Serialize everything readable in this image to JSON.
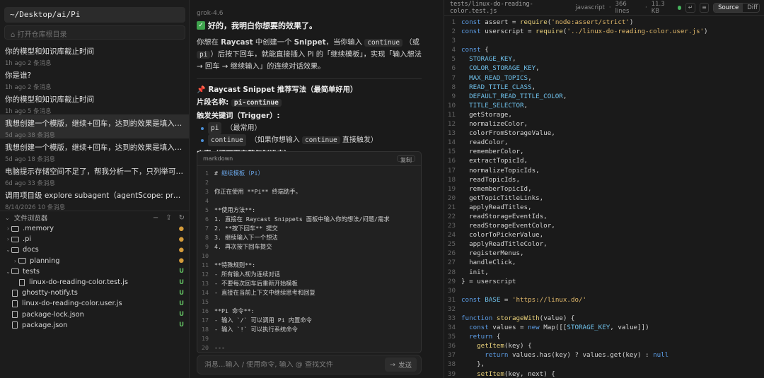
{
  "left": {
    "path": "~/Desktop/ai/Pi",
    "repo_placeholder": "打开仓库根目录",
    "sessions": [
      {
        "title": "你的模型和知识库截止时间",
        "meta": "1h ago  2 条消息",
        "active": false
      },
      {
        "title": "你是谁?",
        "meta": "1h ago  2 条消息",
        "active": false
      },
      {
        "title": "你的模型和知识库截止时间",
        "meta": "1h ago  5 条消息",
        "active": false
      },
      {
        "title": "我想创建一个模版，继续+回车，达到的效果是填入继续并按下回车，模...",
        "meta": "5d ago  38 条消息",
        "active": true
      },
      {
        "title": "我想创建一个模版，继续+回车，达到的效果是填入继续并按下回车，模...",
        "meta": "5d ago  18 条消息",
        "active": false
      },
      {
        "title": "电脑提示存储空间不足了，帮我分析一下，只列举可以清理的内容（不能...",
        "meta": "6d ago  33 条消息",
        "active": false
      },
      {
        "title": "调用项目级 explore subagent（agentScope: project），探索当前工作",
        "meta": "8/14/2026  10 条消息",
        "active": false
      }
    ],
    "files_title": "文件浏览器",
    "tree": [
      {
        "name": ".memory",
        "type": "folder",
        "depth": 0,
        "status": "●"
      },
      {
        "name": ".pi",
        "type": "folder",
        "depth": 0,
        "status": "●"
      },
      {
        "name": "docs",
        "type": "folder",
        "depth": 0,
        "open": true,
        "status": "●"
      },
      {
        "name": "planning",
        "type": "folder",
        "depth": 1,
        "status": "●"
      },
      {
        "name": "tests",
        "type": "folder",
        "depth": 0,
        "open": true,
        "status": "U"
      },
      {
        "name": "linux-do-reading-color.test.js",
        "type": "file",
        "depth": 1,
        "status": "U"
      },
      {
        "name": "ghostty-notify.ts",
        "type": "file",
        "depth": 0,
        "status": "U"
      },
      {
        "name": "linux-do-reading-color.user.js",
        "type": "file",
        "depth": 0,
        "status": "U"
      },
      {
        "name": "package-lock.json",
        "type": "file",
        "depth": 0,
        "status": "U"
      },
      {
        "name": "package.json",
        "type": "file",
        "depth": 0,
        "status": "U"
      }
    ]
  },
  "chat": {
    "model": "grok-4.6",
    "ok_line": "好的，我明白你想要的效果了。",
    "para1_a": "你想在 ",
    "para1_b": "Raycast",
    "para1_c": " 中创建一个 ",
    "para1_d": "Snippet",
    "para1_e": "，当你输入 ",
    "para1_f": "continue",
    "para1_g": " （或 ",
    "para1_h": "pi",
    "para1_i": "）后按下回车，就能直接插入 Pi 的「继续模板」，实现「输入想法 → 回车 → 继续输入」的连续对话效果。",
    "heading": "Raycast Snippet 推荐写法（最简单好用）",
    "name_label": "片段名称:",
    "name_value": "pi-continue",
    "trigger_label": "触发关键词（Trigger）:",
    "bullet1_code": "pi",
    "bullet1_text": "（最常用）",
    "bullet2_code": "continue",
    "bullet2_text_a": "（如果你想输入 ",
    "bullet2_code2": "continue",
    "bullet2_text_b": " 直接触发）",
    "content_label": "内容（把下面完整复制进去）:",
    "code_lang": "markdown",
    "copy_label": "复制",
    "code_lines": [
      "# 继续模板（Pi）",
      "",
      "你正在使用 **Pi** 终端助手。",
      "",
      "**使用方法**:",
      "1. 直接在 Raycast Snippets 面板中输入你的想法/问题/需求",
      "2. **按下回车** 提交",
      "3. 继续输入下一个想法",
      "4. 再次按下回车提交",
      "",
      "**特殊规则**:",
      "- 所有输入视为连续对话",
      "- 不要每次回车后重新开始模板",
      "- 直接在当前上下文中继续思考和回复",
      "",
      "**Pi 命令**:",
      "- 输入 `/` 可以调用 Pi 内置命令",
      "- 输入 `!` 可以执行系统命令",
      "",
      "---"
    ],
    "input_placeholder": "消息...输入 / 使用命令, 输入 @ 查找文件",
    "send_label": "发送"
  },
  "editor": {
    "path": "tests/linux-do-reading-color.test.js",
    "lang": "javascript",
    "lines_info": "366 lines",
    "size": "11.3 KB",
    "source_label": "Source",
    "diff_label": "Diff",
    "code": [
      "const assert = require('node:assert/strict')",
      "const userscript = require('../linux-do-reading-color.user.js')",
      "",
      "const {",
      "  STORAGE_KEY,",
      "  COLOR_STORAGE_KEY,",
      "  MAX_READ_TOPICS,",
      "  READ_TITLE_CLASS,",
      "  DEFAULT_READ_TITLE_COLOR,",
      "  TITLE_SELECTOR,",
      "  getStorage,",
      "  normalizeColor,",
      "  colorFromStorageValue,",
      "  readColor,",
      "  rememberColor,",
      "  extractTopicId,",
      "  normalizeTopicIds,",
      "  readTopicIds,",
      "  rememberTopicId,",
      "  getTopicTitleLinks,",
      "  applyReadTitles,",
      "  readStorageEventIds,",
      "  readStorageEventColor,",
      "  colorToPickerValue,",
      "  applyReadTitleColor,",
      "  registerMenus,",
      "  handleClick,",
      "  init,",
      "} = userscript",
      "",
      "const BASE = 'https://linux.do/'",
      "",
      "function storageWith(value) {",
      "  const values = new Map([[STORAGE_KEY, value]])",
      "  return {",
      "    getItem(key) {",
      "      return values.has(key) ? values.get(key) : null",
      "    },",
      "    setItem(key, next) {"
    ]
  }
}
